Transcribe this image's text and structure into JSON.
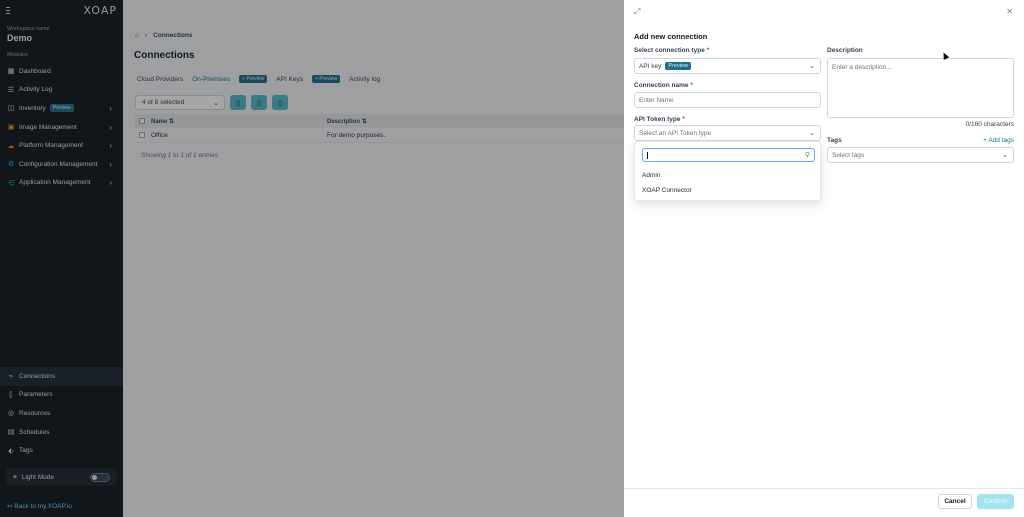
{
  "app": {
    "logo": "XOAP",
    "workspace_label": "Workspace name",
    "workspace_name": "Demo",
    "modules_label": "Modules"
  },
  "sidebar": {
    "items": [
      {
        "label": "Dashboard",
        "icon": "dashboard-icon"
      },
      {
        "label": "Activity Log",
        "icon": "list-icon"
      },
      {
        "label": "Inventory",
        "icon": "box-icon",
        "badge": "Preview"
      },
      {
        "label": "Image Management",
        "icon": "image-icon"
      },
      {
        "label": "Platform Management",
        "icon": "cloud-icon"
      },
      {
        "label": "Configuration Management",
        "icon": "gear-icon"
      },
      {
        "label": "Application Management",
        "icon": "share-icon"
      }
    ],
    "bottom_items": [
      {
        "label": "Connections",
        "icon": "plug-icon"
      },
      {
        "label": "Parameters",
        "icon": "brackets-icon"
      },
      {
        "label": "Resources",
        "icon": "globe-icon"
      },
      {
        "label": "Schedules",
        "icon": "calendar-icon"
      },
      {
        "label": "Tags",
        "icon": "tag-icon"
      }
    ],
    "light_mode_label": "Light Mode",
    "light_mode_on": false,
    "back_link": "Back to my.XOAP.io"
  },
  "main": {
    "breadcrumb": "Connections",
    "title": "Connections",
    "tabs": [
      {
        "label": "Cloud Providers"
      },
      {
        "label": "On-Premises",
        "badge": "+ Preview",
        "active": true
      },
      {
        "label": "API Keys",
        "badge": "+ Preview"
      },
      {
        "label": "Activity log"
      }
    ],
    "selection": "4 of 8 selected",
    "columns": {
      "name": "Name",
      "description": "Description"
    },
    "rows": [
      {
        "name": "Office",
        "description": "For demo purposes."
      }
    ],
    "footer": "Showing 1 to 1 of 1 entries"
  },
  "drawer": {
    "title": "Add new connection",
    "connection_type_label": "Select connection type",
    "connection_type_value": "API key",
    "connection_type_badge": "Preview",
    "connection_name_label": "Connection name",
    "connection_name_placeholder": "Enter Name",
    "token_type_label": "API Token type",
    "token_type_placeholder": "Select an API Token type",
    "token_options": [
      "Admin",
      "XOAP Connector"
    ],
    "description_label": "Description",
    "description_placeholder": "Enter a description...",
    "char_counter": "0/160 characters",
    "tags_label": "Tags",
    "add_tags": "Add tags",
    "tags_placeholder": "Select tags",
    "cancel": "Cancel",
    "confirm": "Confirm",
    "required_mark": "*"
  }
}
